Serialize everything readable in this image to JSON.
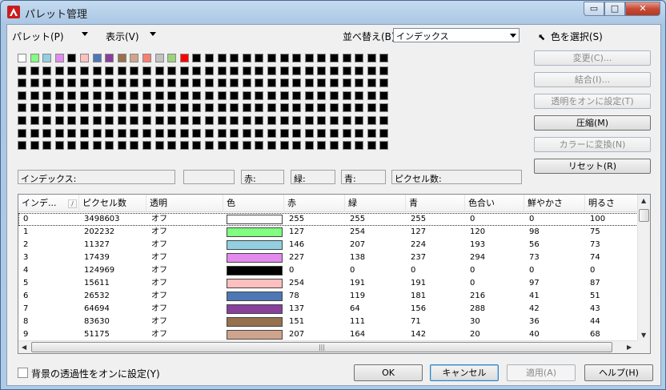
{
  "window": {
    "title": "パレット管理",
    "controls": {
      "minimize": "▭",
      "maximize": "□",
      "close": "✕"
    }
  },
  "menu": {
    "palette": "パレット(P)",
    "view": "表示(V)",
    "sort_label": "並べ替え(B):",
    "sort_value": "インデックス",
    "select_color": "色を選択(S)"
  },
  "swatches": {
    "colors": [
      "#ffffff",
      "#80ff80",
      "#92cfe0",
      "#e38aed",
      "#000000",
      "#febfbf",
      "#4e77b5",
      "#893f9c",
      "#97704d",
      "#cfa48c",
      "#f97f71",
      "#c2c2c2",
      "#9cd37a",
      "#ff0000"
    ],
    "total_cells": 240,
    "empty_color": "#000000"
  },
  "buttons": {
    "change": "変更(C)...",
    "merge": "結合(I)...",
    "transparency_on": "透明をオンに設定(T)",
    "compress": "圧縮(M)",
    "convert_color": "カラーに変換(N)",
    "reset": "リセット(R)"
  },
  "info": {
    "index": "インデックス:",
    "red": "赤:",
    "green": "緑:",
    "blue": "青:",
    "pixel_count": "ピクセル数:"
  },
  "table": {
    "columns": [
      "インデ...",
      "ピクセル数",
      "透明",
      "色",
      "赤",
      "緑",
      "青",
      "色合い",
      "鮮やかさ",
      "明るさ"
    ],
    "sort_indicator": "/",
    "rows": [
      {
        "index": "0",
        "pixels": "3498603",
        "transparent": "オフ",
        "color": "#ffffff",
        "r": "255",
        "g": "255",
        "b": "255",
        "hue": "0",
        "sat": "0",
        "lum": "100"
      },
      {
        "index": "1",
        "pixels": "202232",
        "transparent": "オフ",
        "color": "#80ff80",
        "r": "127",
        "g": "254",
        "b": "127",
        "hue": "120",
        "sat": "98",
        "lum": "75"
      },
      {
        "index": "2",
        "pixels": "11327",
        "transparent": "オフ",
        "color": "#92cfe0",
        "r": "146",
        "g": "207",
        "b": "224",
        "hue": "193",
        "sat": "56",
        "lum": "73"
      },
      {
        "index": "3",
        "pixels": "17439",
        "transparent": "オフ",
        "color": "#e38aed",
        "r": "227",
        "g": "138",
        "b": "237",
        "hue": "294",
        "sat": "73",
        "lum": "74"
      },
      {
        "index": "4",
        "pixels": "124969",
        "transparent": "オフ",
        "color": "#000000",
        "r": "0",
        "g": "0",
        "b": "0",
        "hue": "0",
        "sat": "0",
        "lum": "0"
      },
      {
        "index": "5",
        "pixels": "15611",
        "transparent": "オフ",
        "color": "#febfbf",
        "r": "254",
        "g": "191",
        "b": "191",
        "hue": "0",
        "sat": "97",
        "lum": "87"
      },
      {
        "index": "6",
        "pixels": "26532",
        "transparent": "オフ",
        "color": "#4e77b5",
        "r": "78",
        "g": "119",
        "b": "181",
        "hue": "216",
        "sat": "41",
        "lum": "51"
      },
      {
        "index": "7",
        "pixels": "64694",
        "transparent": "オフ",
        "color": "#893f9c",
        "r": "137",
        "g": "64",
        "b": "156",
        "hue": "288",
        "sat": "42",
        "lum": "43"
      },
      {
        "index": "8",
        "pixels": "83630",
        "transparent": "オフ",
        "color": "#97704d",
        "r": "151",
        "g": "111",
        "b": "71",
        "hue": "30",
        "sat": "36",
        "lum": "44"
      },
      {
        "index": "9",
        "pixels": "51175",
        "transparent": "オフ",
        "color": "#cfa48c",
        "r": "207",
        "g": "164",
        "b": "142",
        "hue": "20",
        "sat": "40",
        "lum": "68"
      }
    ]
  },
  "footer": {
    "bg_transparency": "背景の透過性をオンに設定(Y)",
    "ok": "OK",
    "cancel": "キャンセル",
    "apply": "適用(A)",
    "help": "ヘルプ(H)"
  }
}
